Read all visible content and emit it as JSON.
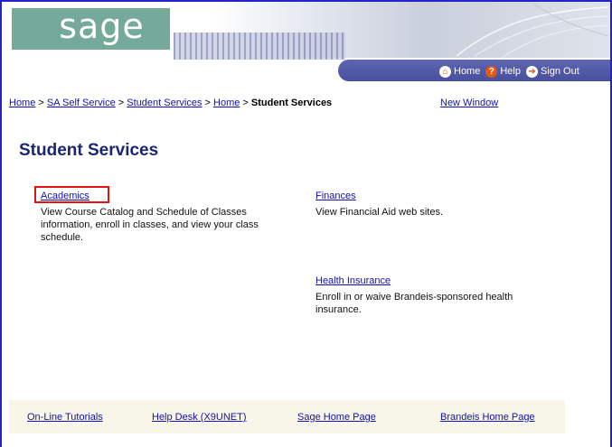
{
  "header": {
    "logo_text": "sage",
    "nav": {
      "home": "Home",
      "help": "Help",
      "signout": "Sign Out"
    }
  },
  "breadcrumb": {
    "items": [
      "Home",
      "SA Self Service",
      "Student Services",
      "Home"
    ],
    "separator": ">",
    "current": "Student Services"
  },
  "new_window": "New Window",
  "page_title": "Student Services",
  "services": {
    "academics": {
      "label": "Academics",
      "description": "View Course Catalog and Schedule of Classes information, enroll in classes, and view your class schedule."
    },
    "finances": {
      "label": "Finances",
      "description": "View Financial Aid web sites."
    },
    "health": {
      "label": "Health Insurance",
      "description": "Enroll in or waive Brandeis-sponsored health insurance."
    }
  },
  "footer": {
    "links": [
      "On-Line Tutorials",
      "Help Desk (X9UNET)",
      "Sage Home Page",
      "Brandeis Home Page"
    ]
  },
  "colors": {
    "frame_border": "#2323c8",
    "logo_bg": "#75a999",
    "navbar": "#525aa8",
    "link": "#1010b4",
    "title": "#1a2675",
    "highlight_box": "#e01414",
    "footer_bg": "#f7f6e9"
  },
  "icons": {
    "home": "home-icon",
    "help": "help-icon",
    "signout": "sign-out-icon"
  }
}
